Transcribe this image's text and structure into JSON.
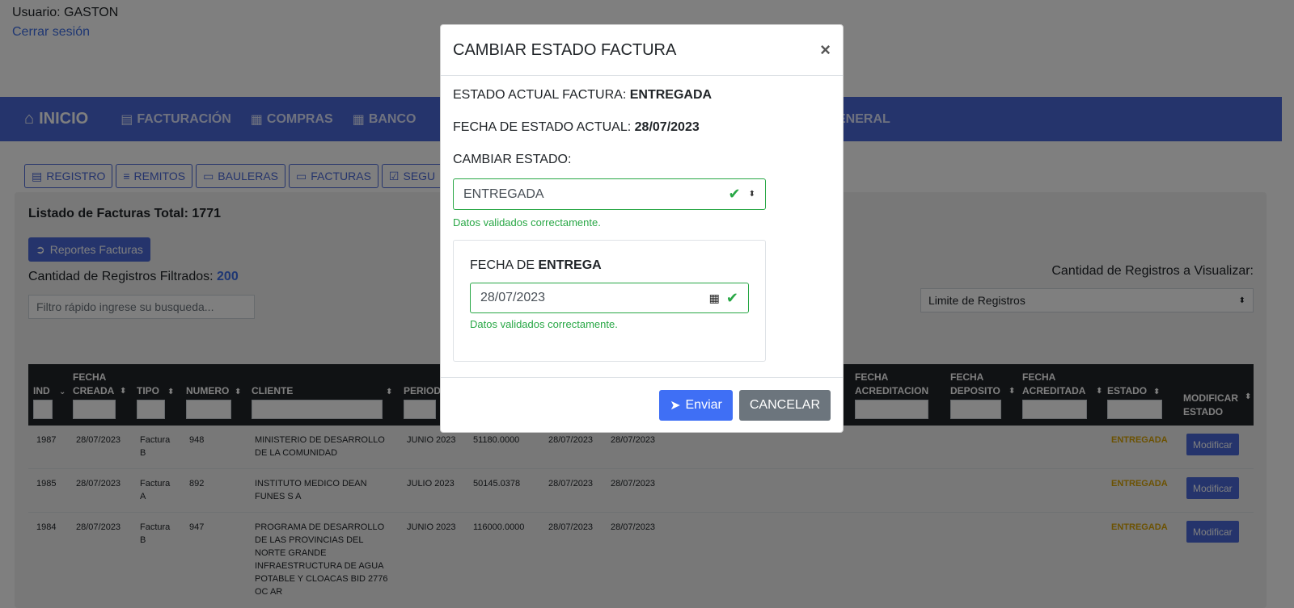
{
  "header": {
    "user_label": "Usuario: GASTON",
    "logout_label": "Cerrar sesión"
  },
  "navbar": {
    "brand_label": "INICIO",
    "items": [
      {
        "label": "FACTURACIÓN",
        "icon": "receipt-icon"
      },
      {
        "label": "COMPRAS",
        "icon": "building-icon"
      },
      {
        "label": "BANCO",
        "icon": "building-icon"
      },
      {
        "label": "ENERAL",
        "icon": ""
      }
    ]
  },
  "subnav": {
    "items": [
      {
        "label": "REGISTRO",
        "icon": "receipt-icon"
      },
      {
        "label": "REMITOS",
        "icon": "database-icon"
      },
      {
        "label": "BAULERAS",
        "icon": "monitor-icon"
      },
      {
        "label": "FACTURAS",
        "icon": "monitor-icon"
      },
      {
        "label": "SEGU",
        "icon": "checkbox-icon"
      }
    ]
  },
  "list": {
    "title": "Listado de Facturas Total: 1771",
    "report_button": "Reportes Facturas",
    "filtered_label": "Cantidad de Registros Filtrados:",
    "filtered_count": "200",
    "quick_filter_placeholder": "Filtro rápido ingrese su busqueda...",
    "limit_label": "Cantidad de Registros a Visualizar:",
    "limit_select": "Limite de Registros"
  },
  "table": {
    "headers": {
      "ind": "IND",
      "fecha_creada_1": "FECHA",
      "fecha_creada_2": "CREADA",
      "tipo": "TIPO",
      "numero": "NUMERO",
      "cliente": "CLIENTE",
      "periodo": "PERIOD",
      "fecha_acred_1": "FECHA",
      "fecha_acred_2": "ACREDITACION",
      "fecha_dep_1": "FECHA",
      "fecha_dep_2": "DEPOSITO",
      "fecha_acda_1": "FECHA",
      "fecha_acda_2": "ACREDITADA",
      "estado": "ESTADO",
      "modificar_1": "MODIFICAR",
      "modificar_2": "ESTADO"
    },
    "rows": [
      {
        "ind": "1987",
        "fecha": "28/07/2023",
        "tipo_1": "Factura",
        "tipo_2": "B",
        "numero": "948",
        "cliente_1": "MINISTERIO DE DESARROLLO",
        "cliente_2": "DE LA COMUNIDAD",
        "periodo": "JUNIO 2023",
        "monto": "51180.0000",
        "f1": "28/07/2023",
        "f2": "28/07/2023",
        "estado": "ENTREGADA",
        "action": "Modificar"
      },
      {
        "ind": "1985",
        "fecha": "28/07/2023",
        "tipo_1": "Factura",
        "tipo_2": "A",
        "numero": "892",
        "cliente_1": "INSTITUTO MEDICO DEAN",
        "cliente_2": "FUNES S A",
        "periodo": "JULIO 2023",
        "monto": "50145.0378",
        "f1": "28/07/2023",
        "f2": "28/07/2023",
        "estado": "ENTREGADA",
        "action": "Modificar"
      },
      {
        "ind": "1984",
        "fecha": "28/07/2023",
        "tipo_1": "Factura",
        "tipo_2": "B",
        "numero": "947",
        "cliente_1": "PROGRAMA DE DESARROLLO",
        "cliente_2": "DE LAS PROVINCIAS DEL",
        "cliente_3": "NORTE GRANDE",
        "cliente_4": "INFRAESTRUCTURA DE AGUA",
        "cliente_5": "POTABLE Y CLOACAS BID 2776",
        "cliente_6": "OC AR",
        "periodo": "JUNIO 2023",
        "monto": "116000.0000",
        "f1": "28/07/2023",
        "f2": "28/07/2023",
        "estado": "ENTREGADA",
        "action": "Modificar"
      }
    ]
  },
  "modal": {
    "title": "CAMBIAR ESTADO FACTURA",
    "close_symbol": "×",
    "estado_actual_label": "ESTADO ACTUAL FACTURA:",
    "estado_actual_value": "ENTREGADA",
    "fecha_estado_label": "FECHA DE ESTADO ACTUAL:",
    "fecha_estado_value": "28/07/2023",
    "cambiar_label": "CAMBIAR ESTADO:",
    "select_value": "ENTREGADA",
    "valid_msg": "Datos validados correctamente.",
    "fecha_de_label": "FECHA DE",
    "fecha_de_bold": "ENTREGA",
    "date_value": "28/07/2023",
    "date_valid_msg": "Datos validados correctamente.",
    "send_label": "Enviar",
    "cancel_label": "CANCELAR"
  },
  "colors": {
    "primary": "#4a68d8",
    "success": "#28a745",
    "warning": "#d9a404",
    "dark": "#212529"
  }
}
